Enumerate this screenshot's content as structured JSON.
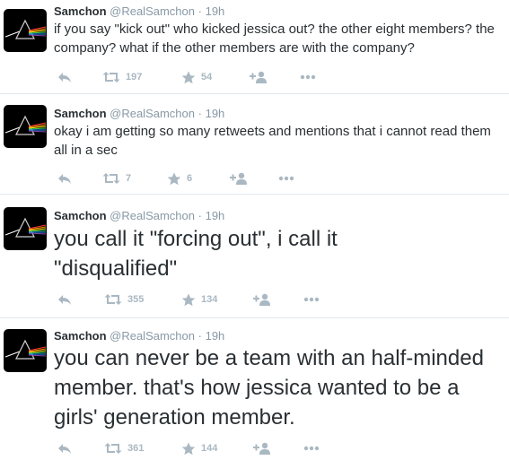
{
  "tweets": [
    {
      "name": "Samchon",
      "handle": "@RealSamchon",
      "dot": "·",
      "time": "19h",
      "text": "if you say \"kick out\" who kicked jessica out? the other eight members? the company? what if the other members are with the company?",
      "retweets": "197",
      "favorites": "54"
    },
    {
      "name": "Samchon",
      "handle": "@RealSamchon",
      "dot": "·",
      "time": "19h",
      "text": "okay i am getting so many retweets and mentions that i cannot read them all in a sec",
      "retweets": "7",
      "favorites": "6"
    },
    {
      "name": "Samchon",
      "handle": "@RealSamchon",
      "dot": "·",
      "time": "19h",
      "text": "you call it \"forcing out\", i call it \"disqualified\"",
      "retweets": "355",
      "favorites": "134"
    },
    {
      "name": "Samchon",
      "handle": "@RealSamchon",
      "dot": "·",
      "time": "19h",
      "text": "you can never be a team with an half-minded member. that's how jessica wanted to be a girls' generation member.",
      "retweets": "361",
      "favorites": "144"
    }
  ],
  "icons": {
    "avatar": "prism-avatar",
    "reply": "reply-icon",
    "retweet": "retweet-icon",
    "favorite": "star-icon",
    "follow": "follow-icon",
    "more": "more-icon"
  },
  "colors": {
    "text": "#292f33",
    "meta": "#8899a6",
    "action": "#aab8c2",
    "divider": "#e1e8ed"
  }
}
